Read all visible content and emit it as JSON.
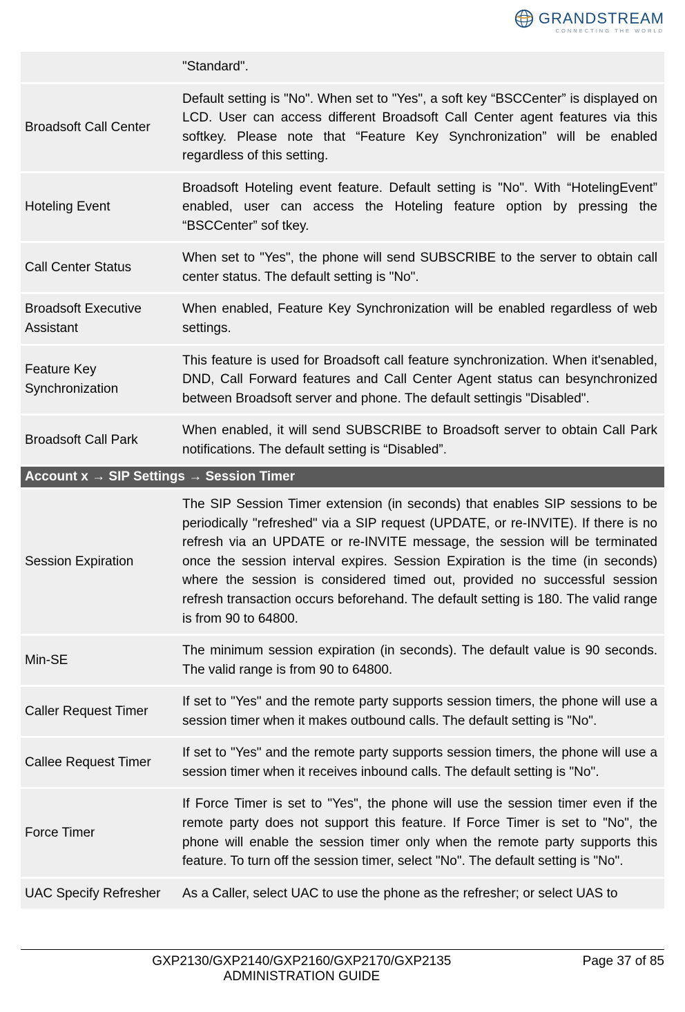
{
  "logo": {
    "brand": "GRANDSTREAM",
    "tagline": "CONNECTING THE WORLD"
  },
  "rows": [
    {
      "label": "",
      "desc": "\"Standard\"."
    },
    {
      "label": "Broadsoft Call Center",
      "desc": "Default setting is \"No\". When set to \"Yes\", a soft key “BSCCenter” is displayed on LCD. User can access different Broadsoft Call Center agent features via this softkey. Please note that “Feature Key Synchronization” will be enabled regardless of this setting."
    },
    {
      "label": "Hoteling Event",
      "desc": "Broadsoft Hoteling event feature. Default setting is \"No\". With “HotelingEvent” enabled, user can access the Hoteling feature option by pressing the “BSCCenter” sof tkey."
    },
    {
      "label": "Call Center Status",
      "desc": "When set to \"Yes\", the phone will send SUBSCRIBE to the server to obtain call center status. The default setting is \"No\"."
    },
    {
      "label": "Broadsoft Executive Assistant",
      "desc": "When enabled, Feature Key Synchronization will be enabled regardless of web settings."
    },
    {
      "label": "Feature Key Synchronization",
      "desc": "This feature is used for Broadsoft call feature synchronization. When it'senabled, DND, Call Forward features and Call Center Agent status can besynchronized between Broadsoft server and phone. The default settingis \"Disabled\"."
    },
    {
      "label": "Broadsoft Call Park",
      "desc": "When enabled, it will send SUBSCRIBE to Broadsoft server to obtain Call Park notifications. The default setting is “Disabled”."
    }
  ],
  "section_header": {
    "prefix": "Account x ",
    "mid": " SIP Settings ",
    "suffix": " Session Timer"
  },
  "rows2": [
    {
      "label": "Session Expiration",
      "desc": "The SIP Session Timer extension (in seconds) that enables SIP sessions to be periodically \"refreshed\" via a SIP request (UPDATE, or re-INVITE). If there is no refresh via an UPDATE or re-INVITE message, the session will be terminated once the session interval expires. Session Expiration is the time (in seconds) where the session is considered timed out, provided no successful session refresh transaction occurs beforehand. The default setting is 180. The valid range is from 90 to 64800."
    },
    {
      "label": "Min-SE",
      "desc": "The minimum session expiration (in seconds). The default value is 90 seconds. The valid range is from 90 to 64800."
    },
    {
      "label": "Caller Request Timer",
      "desc": "If set to \"Yes\" and the remote party supports session timers, the phone will use a session timer when it makes outbound calls. The default setting is \"No\"."
    },
    {
      "label": "Callee Request Timer",
      "desc": "If set to \"Yes\" and the remote party supports session timers, the phone will use a session timer when it receives inbound calls. The default setting is \"No\"."
    },
    {
      "label": "Force Timer",
      "desc": "If Force Timer is set to \"Yes\", the phone will use the session timer even if the remote party does not support this feature. If Force Timer is set to \"No\", the phone will enable the session timer only when the remote party supports this feature. To turn off the session timer, select \"No\". The default setting is \"No\"."
    },
    {
      "label": "UAC Specify Refresher",
      "desc": "As a Caller, select UAC to use the phone as the refresher; or select UAS to"
    }
  ],
  "footer": {
    "title_line1": "GXP2130/GXP2140/GXP2160/GXP2170/GXP2135",
    "title_line2": "ADMINISTRATION GUIDE",
    "page": "Page 37 of 85"
  },
  "arrow_glyph": "→"
}
